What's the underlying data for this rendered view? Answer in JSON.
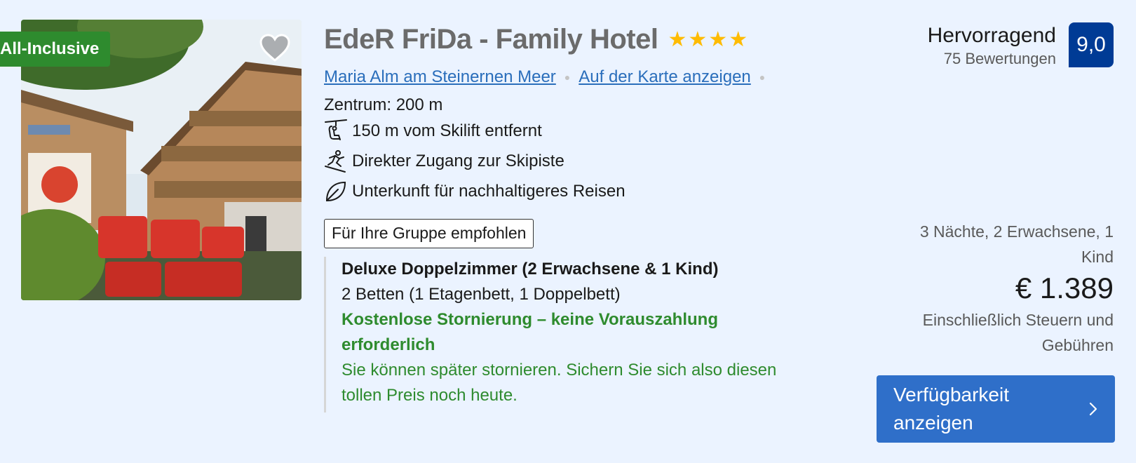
{
  "hotel": {
    "badge": "All-Inclusive",
    "title": "EdeR FriDa - Family Hotel",
    "stars": 4,
    "location_link": "Maria Alm am Steinernen Meer",
    "map_link": "Auf der Karte anzeigen",
    "center_distance": "Zentrum: 200 m",
    "features": [
      {
        "icon": "ski-lift-icon",
        "text": "150 m vom Skilift entfernt"
      },
      {
        "icon": "skier-icon",
        "text": "Direkter Zugang zur Skipiste"
      },
      {
        "icon": "leaf-icon",
        "text": "Unterkunft für nachhaltigeres Reisen"
      }
    ],
    "group_badge": "Für Ihre Gruppe empfohlen"
  },
  "room": {
    "name": "Deluxe Doppelzimmer (2 Erwachsene & 1 Kind)",
    "beds": "2 Betten (1 Etagenbett, 1 Doppelbett)",
    "cancellation": "Kostenlose Stornierung – keine Vorauszahlung erforderlich",
    "note": "Sie können später stornieren. Sichern Sie sich also diesen tollen Preis noch heute."
  },
  "rating": {
    "word": "Hervorragend",
    "count": "75 Bewertungen",
    "score": "9,0"
  },
  "pricing": {
    "stay": "3 Nächte, 2 Erwachsene, 1 Kind",
    "price": "€ 1.389",
    "taxes": "Einschließlich Steuern und Gebühren",
    "cta": "Verfügbarkeit anzeigen"
  },
  "colors": {
    "background": "#ebf3ff",
    "link": "#2a6ebb",
    "score_bg": "#003b95",
    "green": "#2e8b2e",
    "cta_bg": "#2f6fc9",
    "star": "#febb02"
  }
}
